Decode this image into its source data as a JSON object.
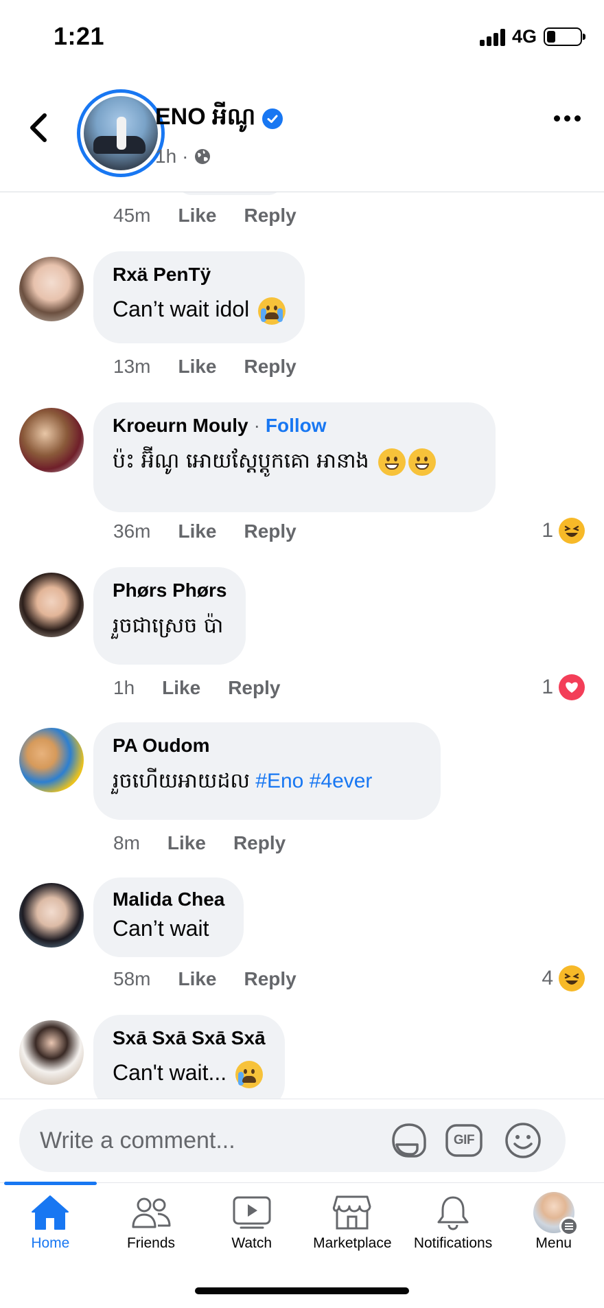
{
  "status": {
    "time": "1:21",
    "network": "4G"
  },
  "post": {
    "author": "ENO អីណូ",
    "time": "1h",
    "separator": "·"
  },
  "previous_comment": {
    "time": "45m",
    "like": "Like",
    "reply": "Reply"
  },
  "comments": [
    {
      "author": "Rxä PenTÿ",
      "text": "Can’t wait idol",
      "emoji": "crying",
      "time": "13m",
      "like": "Like",
      "reply": "Reply"
    },
    {
      "author": "Kroeurn Mouly",
      "follow": "Follow",
      "follow_sep": "·",
      "text": "ប៉ះ អ៊ីណូ អោយស្ដែប្ដូកគោ អានាង",
      "emoji": "grinning",
      "time": "36m",
      "like": "Like",
      "reply": "Reply",
      "reaction_count": "1",
      "reaction": "haha"
    },
    {
      "author": "Phørs Phørs",
      "text": "រួចជាស្រេច ប៉ា",
      "time": "1h",
      "like": "Like",
      "reply": "Reply",
      "reaction_count": "1",
      "reaction": "love"
    },
    {
      "author": "PA Oudom",
      "text": "រួចហើយអាយដល",
      "hashtags": "#Eno #4ever",
      "time": "8m",
      "like": "Like",
      "reply": "Reply"
    },
    {
      "author": "Malida Chea",
      "text": "Can’t wait",
      "time": "58m",
      "like": "Like",
      "reply": "Reply",
      "reaction_count": "4",
      "reaction": "haha"
    },
    {
      "author": "Sxā Sxā Sxā Sxā",
      "text": "Can't wait...",
      "emoji": "sad-tear"
    }
  ],
  "composer": {
    "placeholder": "Write a comment...",
    "gif_label": "GIF"
  },
  "nav": [
    {
      "label": "Home",
      "icon": "home-icon",
      "active": true
    },
    {
      "label": "Friends",
      "icon": "friends-icon"
    },
    {
      "label": "Watch",
      "icon": "watch-icon"
    },
    {
      "label": "Marketplace",
      "icon": "marketplace-icon"
    },
    {
      "label": "Notifications",
      "icon": "bell-icon"
    },
    {
      "label": "Menu",
      "icon": "menu-avatar"
    }
  ],
  "colors": {
    "accent": "#1877f2",
    "bubble": "#f0f2f5",
    "secondary_text": "#65676b"
  }
}
